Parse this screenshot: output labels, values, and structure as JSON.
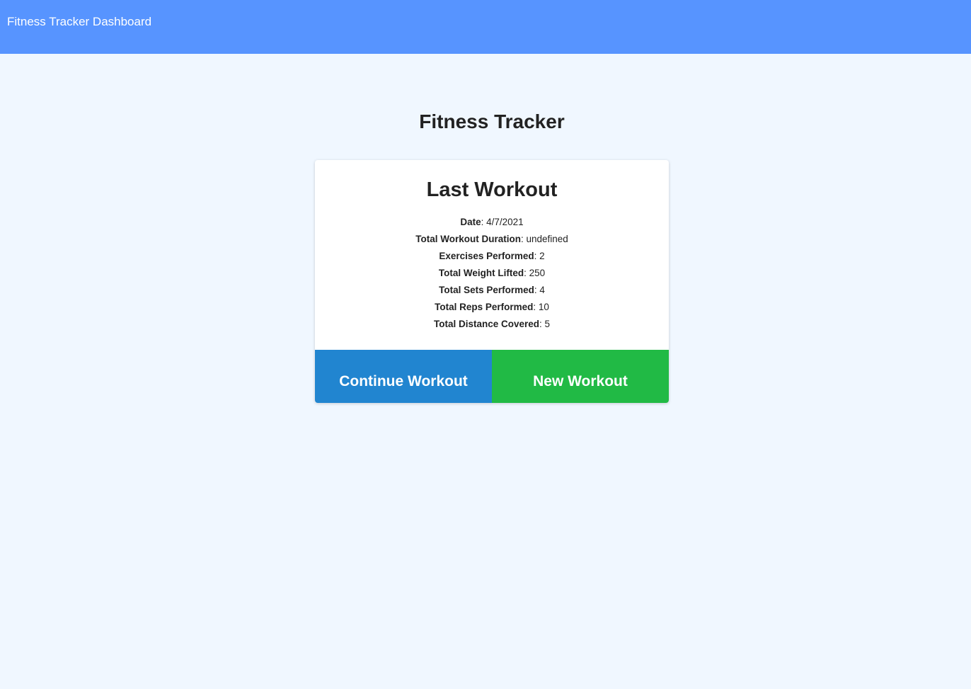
{
  "header": {
    "brand": "Fitness Tracker Dashboard"
  },
  "main": {
    "title": "Fitness Tracker"
  },
  "card": {
    "title": "Last Workout",
    "stats": [
      {
        "label": "Date",
        "value": "4/7/2021"
      },
      {
        "label": "Total Workout Duration",
        "value": "undefined"
      },
      {
        "label": "Exercises Performed",
        "value": "2"
      },
      {
        "label": "Total Weight Lifted",
        "value": "250"
      },
      {
        "label": "Total Sets Performed",
        "value": "4"
      },
      {
        "label": "Total Reps Performed",
        "value": "10"
      },
      {
        "label": "Total Distance Covered",
        "value": "5"
      }
    ],
    "continue_label": "Continue Workout",
    "new_label": "New Workout"
  },
  "colors": {
    "header_bg": "#5794ff",
    "page_bg": "#f0f7ff",
    "continue_bg": "#2185d0",
    "new_bg": "#21ba45"
  }
}
